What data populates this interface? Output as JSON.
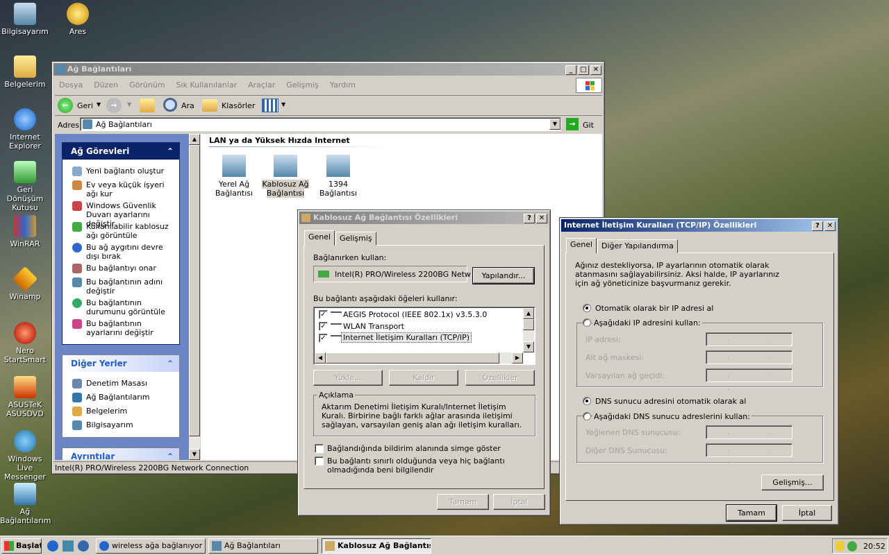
{
  "desktop_icons": [
    "Bilgisayarım",
    "Ares",
    "Belgelerim",
    "Internet Explorer",
    "Geri Dönüşüm Kutusu",
    "WinRAR",
    "Winamp",
    "Nero StartSmart",
    "ASUSTeK ASUSDVD",
    "Windows Live Messenger",
    "Ağ Bağlantılarım"
  ],
  "explorer": {
    "title": "Ağ Bağlantıları",
    "menu": [
      "Dosya",
      "Düzen",
      "Görünüm",
      "Sık Kullanılanlar",
      "Araçlar",
      "Gelişmiş",
      "Yardım"
    ],
    "toolbar": {
      "back": "Geri",
      "search": "Ara",
      "folders": "Klasörler"
    },
    "address_label": "Adres",
    "address_value": "Ağ Bağlantıları",
    "go_label": "Git",
    "tasks_header": "Ağ Görevleri",
    "tasks": [
      "Yeni bağlantı oluştur",
      "Ev veya küçük işyeri ağı kur",
      "Windows Güvenlik Duvarı ayarlarını değiştir",
      "Kullanılabilir kablosuz ağı görüntüle",
      "Bu ağ aygıtını devre dışı bırak",
      "Bu bağlantıyı onar",
      "Bu bağlantının adını değiştir",
      "Bu bağlantının durumunu görüntüle",
      "Bu bağlantının ayarlarını değiştir"
    ],
    "places_header": "Diğer Yerler",
    "places": [
      "Denetim Masası",
      "Ağ Bağlantılarım",
      "Belgelerim",
      "Bilgisayarım"
    ],
    "details_header": "Ayrıntılar",
    "section_title": "LAN ya da Yüksek Hızda Internet",
    "connections": [
      "Yerel Ağ Bağlantısı",
      "Kablosuz Ağ Bağlantısı",
      "1394 Bağlantısı"
    ],
    "status": "Intel(R) PRO/Wireless 2200BG Network Connection"
  },
  "props": {
    "title": "Kablosuz Ağ Bağlantısı Özellikleri",
    "tabs": [
      "Genel",
      "Gelişmiş"
    ],
    "connect_using_label": "Bağlanırken kullan:",
    "adapter": "Intel(R) PRO/Wireless 2200BG Netw",
    "configure": "Yapılandır...",
    "items_label": "Bu bağlantı aşağıdaki öğeleri kullanır:",
    "items": [
      "AEGIS Protocol (IEEE 802.1x) v3.5.3.0",
      "WLAN Transport",
      "Internet İletişim Kuralları (TCP/IP)"
    ],
    "install": "Yükle...",
    "uninstall": "Kaldır",
    "properties": "Özellikler",
    "desc_label": "Açıklama",
    "desc_text": "Aktarım Denetimi İletişim Kuralı/Internet İletişim Kuralı. Birbirine bağlı farklı ağlar arasında iletişimi sağlayan, varsayılan geniş alan ağı iletişim kuralları.",
    "show_icon": "Bağlandığında bildirim alanında simge göster",
    "notify": "Bu bağlantı sınırlı olduğunda veya hiç bağlantı olmadığında beni bilgilendir",
    "ok": "Tamam",
    "cancel": "İptal"
  },
  "tcpip": {
    "title": "Internet İletişim Kuralları (TCP/IP) Özellikleri",
    "tabs": [
      "Genel",
      "Diğer Yapılandırma"
    ],
    "intro": "Ağınız destekliyorsa, IP ayarlarının otomatik olarak atanmasını sağlayabilirsiniz. Aksi halde, IP ayarlarınız için ağ yöneticinize başvurmanız gerekir.",
    "auto_ip": "Otomatik olarak bir IP adresi al",
    "manual_ip": "Aşağıdaki IP adresini kullan:",
    "ip_address": "IP adresi:",
    "subnet": "Alt ağ maskesi:",
    "gateway": "Varsayılan ağ geçidi:",
    "auto_dns": "DNS sunucu adresini otomatik olarak al",
    "manual_dns": "Aşağıdaki DNS sunucu adreslerini kullan:",
    "pref_dns": "Yeğlenen DNS sunucusu:",
    "alt_dns": "Diğer DNS Sunucusu:",
    "ip_placeholder": ". . .",
    "advanced": "Gelişmiş...",
    "ok": "Tamam",
    "cancel": "İptal"
  },
  "taskbar": {
    "start": "Başlat",
    "items": [
      "wireless ağa bağlanıyor ...",
      "Ağ Bağlantıları",
      "Kablosuz Ağ Bağlantıs..."
    ],
    "clock": "20:52"
  }
}
